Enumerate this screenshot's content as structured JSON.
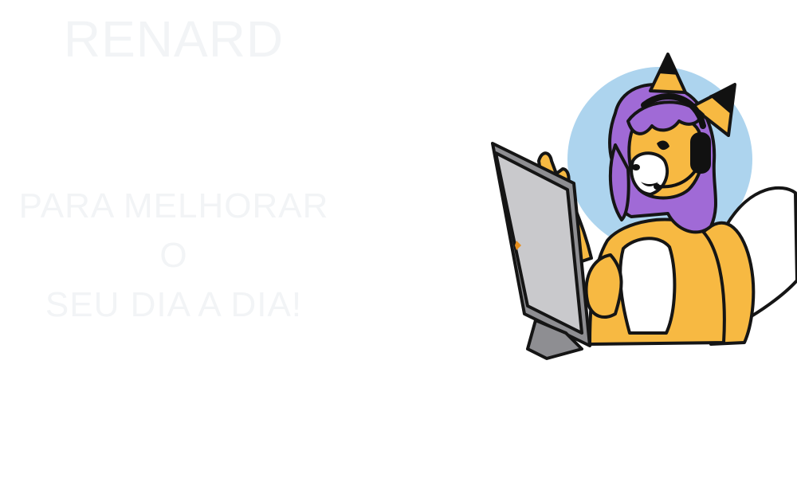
{
  "brand": {
    "name": "RENARD"
  },
  "tagline": {
    "line1": "PARA MELHORAR O",
    "line2": "SEU DIA A DIA!"
  },
  "colors": {
    "text": "#f2f4f6",
    "circle": "#add4ee",
    "fur": "#f7b942",
    "hair": "#a06ad6",
    "hair_dark": "#7e4db8",
    "ear": "#111111",
    "monitor": "#c9c9cc",
    "monitor_dark": "#8e8e92",
    "white": "#ffffff",
    "outline": "#151515",
    "accent": "#e8901e"
  },
  "illustration": {
    "subject": "fox-girl-at-computer",
    "icons": [
      "monitor-icon",
      "headset-icon"
    ]
  }
}
